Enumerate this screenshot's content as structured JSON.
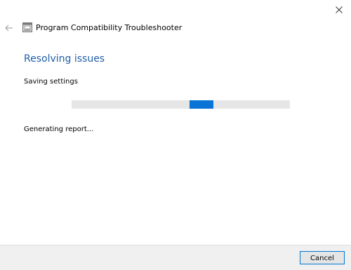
{
  "window": {
    "app_title": "Program Compatibility Troubleshooter"
  },
  "page": {
    "title": "Resolving issues",
    "status": "Saving settings",
    "report_status": "Generating report..."
  },
  "progress": {
    "mode": "indeterminate",
    "chunk_start_fraction": 0.54,
    "chunk_width_fraction": 0.11
  },
  "footer": {
    "cancel_label": "Cancel"
  },
  "icons": {
    "close": "close-icon",
    "back": "back-arrow-icon",
    "app": "troubleshooter-icon"
  },
  "colors": {
    "title_blue": "#1f5ea8",
    "progress_fill": "#0a74d6",
    "progress_track": "#e6e6e6",
    "button_border": "#0078d7"
  }
}
